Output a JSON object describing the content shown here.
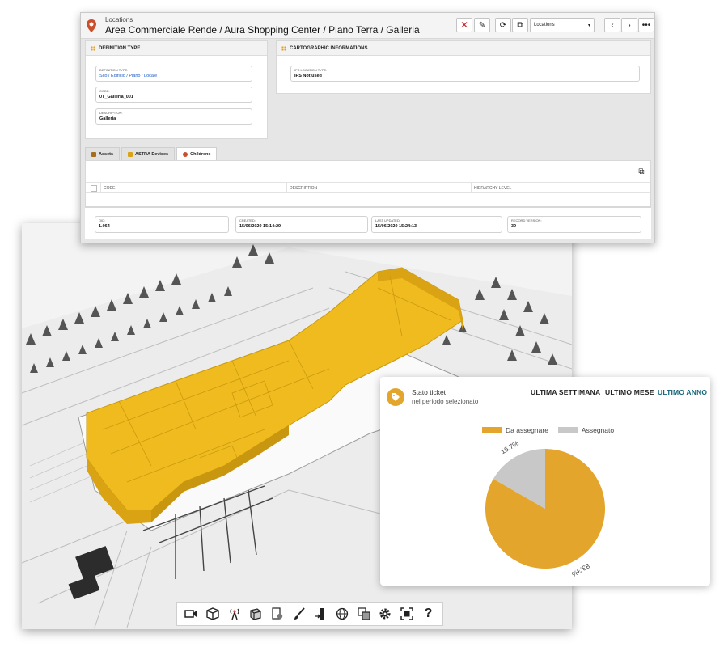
{
  "locations": {
    "app_title": "Locations",
    "breadcrumb": "Area Commerciale Rende / Aura Shopping Center / Piano Terra / Galleria",
    "select_value": "Locations",
    "definition": {
      "heading": "DEFINITION TYPE",
      "fields": [
        {
          "label": "DEFINITION TYPE:",
          "value": "Sito / Edificio / Piano / Locale"
        },
        {
          "label": "CODE:",
          "value": "0T_Galleria_001"
        },
        {
          "label": "DESCRIPTION:",
          "value": "Galleria"
        }
      ]
    },
    "cartographic": {
      "heading": "CARTOGRAPHIC INFORMATIONS",
      "field": {
        "label": "IPS LOCATION TYPE:",
        "value": "IPS Not used"
      }
    },
    "tabs": [
      "Assets",
      "ASTRA Devices",
      "Childrens"
    ],
    "grid_columns": [
      "CODE",
      "DESCRIPTION",
      "HIERARCHY LEVEL"
    ],
    "footer": [
      {
        "label": "OID:",
        "value": "1.064"
      },
      {
        "label": "CREATED:",
        "value": "15/06/2020 15:14:29"
      },
      {
        "label": "LAST UPDATED:",
        "value": "15/06/2020 15:24:13"
      },
      {
        "label": "RECORD VERSION:",
        "value": "39"
      }
    ]
  },
  "viewer": {
    "toolbar_icons": [
      "camera-icon",
      "cube-icon",
      "antenna-icon",
      "box-icon",
      "document-settings-icon",
      "brush-icon",
      "door-icon",
      "globe-icon",
      "layers-icon",
      "gear-icon",
      "fit-screen-icon",
      "help-icon"
    ],
    "help_glyph": "?",
    "highlight_color": "#f0bb1e"
  },
  "ticket": {
    "title": "Stato ticket",
    "subtitle": "nel periodo selezionato",
    "periods": [
      "ULTIMA SETTIMANA",
      "ULTIMO MESE",
      "ULTIMO ANNO"
    ],
    "selected_period": "ULTIMO ANNO",
    "chart_data": {
      "type": "pie",
      "series": [
        {
          "name": "Da assegnare",
          "value": 83.3,
          "label": "83.3%",
          "color": "#e3a52c"
        },
        {
          "name": "Assegnato",
          "value": 16.7,
          "label": "16.7%",
          "color": "#c8c8c8"
        }
      ],
      "legend_position": "top"
    }
  }
}
